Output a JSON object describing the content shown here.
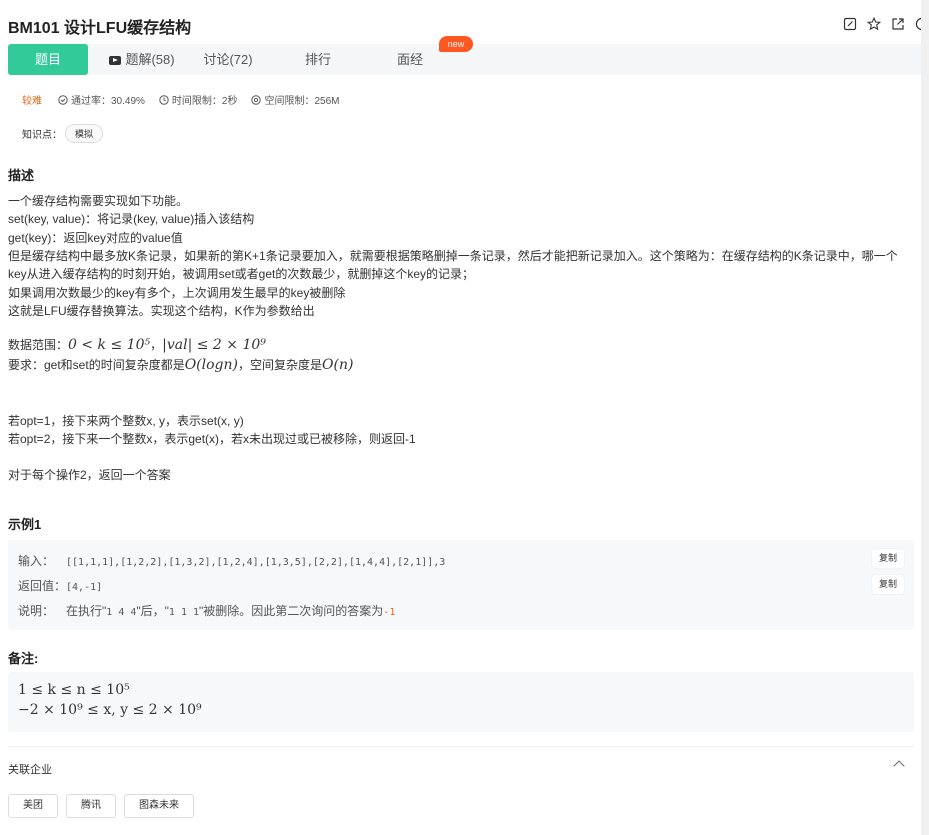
{
  "header": {
    "title": "BM101  设计LFU缓存结构",
    "icons": [
      "edit-icon",
      "star-icon",
      "share-icon",
      "info-icon"
    ]
  },
  "tabs": [
    {
      "label": "题目",
      "active": true
    },
    {
      "label": "题解(58)",
      "icon": "video-icon"
    },
    {
      "label": "讨论(72)"
    },
    {
      "label": "排行"
    },
    {
      "label": "面经",
      "badge": "new"
    }
  ],
  "meta": {
    "difficulty": "较难",
    "pass_rate": "通过率：30.49%",
    "time_limit": "时间限制：2秒",
    "space_limit": "空间限制：256M"
  },
  "knowledge": {
    "label": "知识点：",
    "tag": "模拟"
  },
  "description": {
    "heading": "描述",
    "lines": [
      "一个缓存结构需要实现如下功能。",
      "set(key, value)：将记录(key, value)插入该结构",
      "get(key)：返回key对应的value值",
      "但是缓存结构中最多放K条记录，如果新的第K+1条记录要加入，就需要根据策略删掉一条记录，然后才能把新记录加入。这个策略为：在缓存结构的K条记录中，哪一个",
      "key从进入缓存结构的时刻开始，被调用set或者get的次数最少，就删掉这个key的记录；",
      "如果调用次数最少的key有多个，上次调用发生最早的key被删除",
      "这就是LFU缓存替换算法。实现这个结构，K作为参数给出"
    ],
    "range_label": "数据范围：",
    "range_math_1": "0 < k ≤ 10⁵",
    "range_sep": "，",
    "range_math_2": "|val| ≤ 2 × 10⁹",
    "req_label": "要求：get和set的时间复杂度都是",
    "req_math_1": "O(logn)",
    "req_mid": "，空间复杂度是",
    "req_math_2": "O(n)",
    "opt_lines": [
      "若opt=1，接下来两个整数x, y，表示set(x, y)",
      "若opt=2，接下来一个整数x，表示get(x)，若x未出现过或已被移除，则返回-1"
    ],
    "answer_line": "对于每个操作2，返回一个答案"
  },
  "example": {
    "heading": "示例1",
    "input_label": "输入：",
    "input_value": "[[1,1,1],[1,2,2],[1,3,2],[1,2,4],[1,3,5],[2,2],[1,4,4],[2,1]],3",
    "output_label": "返回值：",
    "output_value": "[4,-1]",
    "explain_label": "说明：",
    "explain_text_1": "在执行\"",
    "explain_code_1": "1 4 4",
    "explain_text_2": "\"后，\"",
    "explain_code_2": "1 1 1",
    "explain_text_3": "\"被删除。因此第二次询问的答案为",
    "explain_code_3": "-1",
    "copy_label": "复制"
  },
  "note": {
    "heading": "备注:",
    "line1": "1 ≤ k ≤ n ≤ 10⁵",
    "line2": "−2 × 10⁹ ≤ x, y ≤ 2 × 10⁹"
  },
  "companies": {
    "title": "关联企业",
    "items": [
      "美团",
      "腾讯",
      "图森未来"
    ]
  },
  "colors": {
    "accent": "#32ca99",
    "badge": "#ff5722",
    "difficulty": "#e8661c"
  }
}
